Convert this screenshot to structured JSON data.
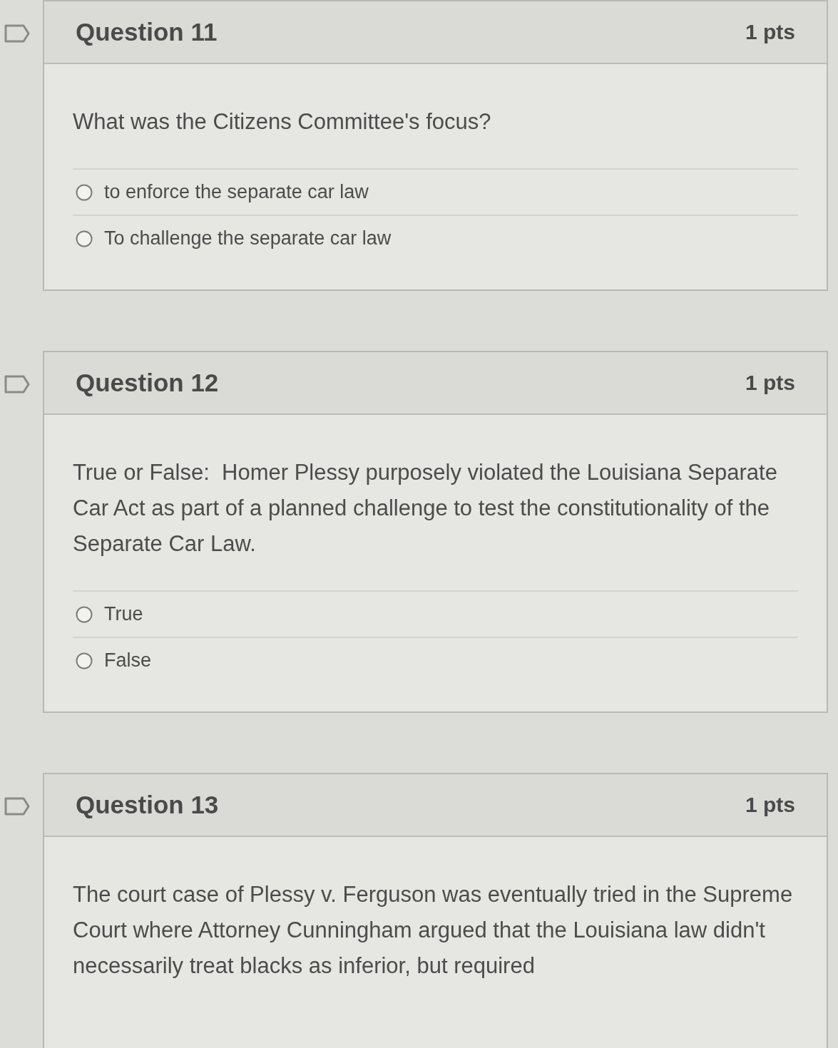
{
  "questions": [
    {
      "title": "Question 11",
      "points": "1 pts",
      "flagged": false,
      "text": "What was the Citizens Committee's focus?",
      "answers": [
        {
          "label": "to enforce the separate car law",
          "selected": false
        },
        {
          "label": "To challenge the separate car law",
          "selected": false
        }
      ]
    },
    {
      "title": "Question 12",
      "points": "1 pts",
      "flagged": false,
      "text": "True or False:  Homer Plessy purposely violated the Louisiana Separate Car Act as part of a planned challenge to test the constitutionality of the Separate Car Law.",
      "answers": [
        {
          "label": "True",
          "selected": false
        },
        {
          "label": "False",
          "selected": false
        }
      ]
    },
    {
      "title": "Question 13",
      "points": "1 pts",
      "flagged": false,
      "text": "The court case of Plessy v. Ferguson was eventually tried in the Supreme Court where Attorney Cunningham argued that the Louisiana law didn't necessarily treat blacks as inferior, but required"
    }
  ]
}
